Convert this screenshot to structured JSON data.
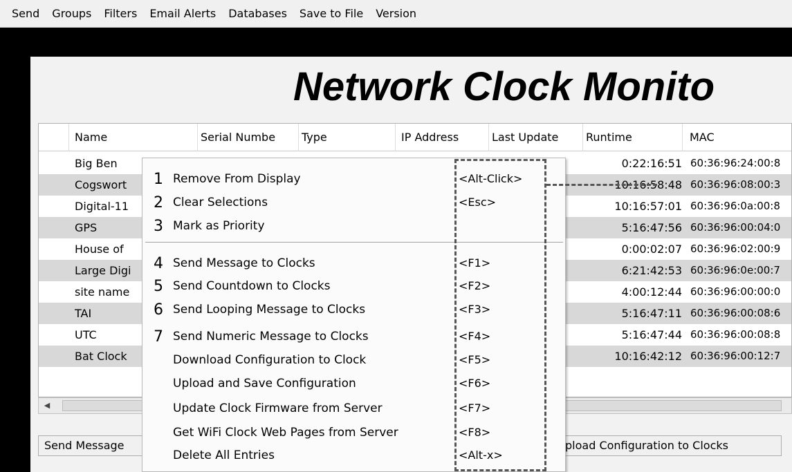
{
  "menubar": {
    "items": [
      "Send",
      "Groups",
      "Filters",
      "Email Alerts",
      "Databases",
      "Save to File",
      "Version"
    ]
  },
  "app": {
    "title": "Network Clock Monito"
  },
  "table": {
    "columns": [
      "Name",
      "Serial Numbe",
      "Type",
      "IP Address",
      "Last Update",
      "Runtime",
      "MAC"
    ],
    "rows": [
      {
        "name": "Big Ben",
        "runtime": "0:22:16:51",
        "mac": "60:36:96:24:00:8"
      },
      {
        "name": "Cogswort",
        "runtime": "10:16:58:48",
        "mac": "60:36:96:08:00:3"
      },
      {
        "name": "Digital-11",
        "runtime": "10:16:57:01",
        "mac": "60:36:96:0a:00:8"
      },
      {
        "name": "GPS",
        "runtime": "5:16:47:56",
        "mac": "60:36:96:00:04:0"
      },
      {
        "name": "House of",
        "runtime": "0:00:02:07",
        "mac": "60:36:96:02:00:9"
      },
      {
        "name": "Large Digi",
        "runtime": "6:21:42:53",
        "mac": "60:36:96:0e:00:7"
      },
      {
        "name": "site name",
        "runtime": "4:00:12:44",
        "mac": "60:36:96:00:00:0"
      },
      {
        "name": "TAI",
        "runtime": "5:16:47:11",
        "mac": "60:36:96:00:08:6"
      },
      {
        "name": "UTC",
        "runtime": "5:16:47:44",
        "mac": "60:36:96:00:08:8"
      },
      {
        "name": "Bat Clock",
        "runtime": "10:16:42:12",
        "mac": "60:36:96:00:12:7"
      }
    ]
  },
  "bottom_buttons": {
    "left": "Send Message",
    "right": "pload Configuration to Clocks"
  },
  "context_menu": {
    "items": [
      {
        "num": "1",
        "label": "Remove From Display",
        "shortcut": "<Alt-Click>"
      },
      {
        "num": "2",
        "label": "Clear Selections",
        "shortcut": "<Esc>"
      },
      {
        "num": "3",
        "label": "Mark as Priority",
        "shortcut": ""
      },
      {
        "num": "4",
        "label": "Send Message to Clocks",
        "shortcut": "<F1>"
      },
      {
        "num": "5",
        "label": "Send Countdown to Clocks",
        "shortcut": "<F2>"
      },
      {
        "num": "6",
        "label": "Send Looping Message to Clocks",
        "shortcut": "<F3>"
      },
      {
        "num": "7",
        "label": "Send Numeric Message to Clocks",
        "shortcut": "<F4>"
      },
      {
        "num": "",
        "label": "Download Configuration to Clock",
        "shortcut": "<F5>"
      },
      {
        "num": "",
        "label": "Upload and Save Configuration",
        "shortcut": "<F6>"
      },
      {
        "num": "",
        "label": "Update Clock Firmware from Server",
        "shortcut": "<F7>"
      },
      {
        "num": "",
        "label": "Get WiFi Clock Web Pages from Server",
        "shortcut": "<F8>"
      },
      {
        "num": "",
        "label": "Delete All Entries",
        "shortcut": "<Alt-x>"
      }
    ]
  },
  "icons": {
    "scroll_left": "chevron-left-icon"
  },
  "colors": {
    "alt_row": "#d8d8d8",
    "frame": "#000000",
    "callout_dash": "#555555"
  }
}
